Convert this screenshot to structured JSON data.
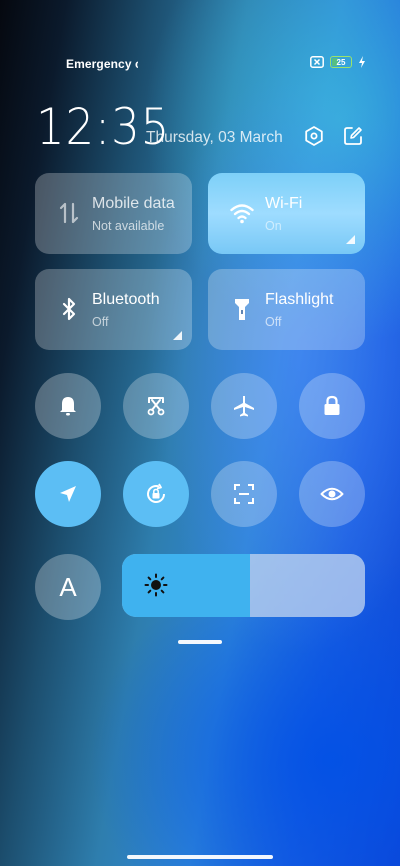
{
  "status_bar": {
    "carrier_text": "Emergency c",
    "sim_icon": "no-sim-icon",
    "battery_percent": "25",
    "battery_level": 0.25,
    "charging_icon": "bolt-icon"
  },
  "header": {
    "time": "12:35",
    "date": "Thursday, 03 March",
    "settings_icon": "hex-settings-icon",
    "edit_icon": "edit-icon"
  },
  "tiles": [
    {
      "title": "Mobile data",
      "subtitle": "Not available",
      "icon": "mobile-data-icon",
      "active": false
    },
    {
      "title": "Wi-Fi",
      "subtitle": "On",
      "icon": "wifi-icon",
      "active": true
    },
    {
      "title": "Bluetooth",
      "subtitle": "Off",
      "icon": "bluetooth-icon",
      "active": false
    },
    {
      "title": "Flashlight",
      "subtitle": "Off",
      "icon": "flashlight-icon",
      "active": false
    }
  ],
  "toggles_row1": [
    {
      "icon": "bell-icon",
      "active": false
    },
    {
      "icon": "screenshot-scissors-icon",
      "active": false
    },
    {
      "icon": "airplane-icon",
      "active": false
    },
    {
      "icon": "lock-icon",
      "active": false
    }
  ],
  "toggles_row2": [
    {
      "icon": "location-arrow-icon",
      "active": true
    },
    {
      "icon": "rotation-lock-icon",
      "active": true
    },
    {
      "icon": "scan-icon",
      "active": false
    },
    {
      "icon": "eye-icon",
      "active": false
    }
  ],
  "font_button": {
    "label": "A"
  },
  "brightness": {
    "level": 0.525,
    "icon": "sun-icon"
  }
}
